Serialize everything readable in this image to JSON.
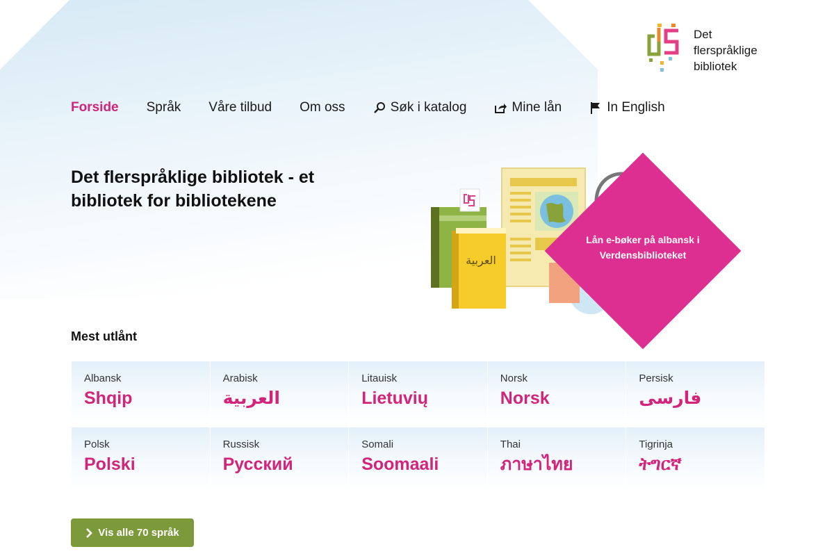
{
  "brand": {
    "logo_lines": [
      "Det",
      "flerspråklige",
      "bibliotek"
    ],
    "colors": {
      "pink": "#d1247a",
      "promo_pink": "#dd2e92",
      "green": "#7c9a3a",
      "bg_blue": "#dcebf6"
    }
  },
  "nav": {
    "items": [
      {
        "label": "Forside",
        "icon": "",
        "active": true
      },
      {
        "label": "Språk",
        "icon": ""
      },
      {
        "label": "Våre tilbud",
        "icon": ""
      },
      {
        "label": "Om oss",
        "icon": ""
      },
      {
        "label": "Søk i katalog",
        "icon": "search-icon"
      },
      {
        "label": "Mine lån",
        "icon": "share-icon"
      },
      {
        "label": "In English",
        "icon": "flag-icon"
      }
    ]
  },
  "hero": {
    "title": "Det flerspråklige bibliotek - et bibliotek for bibliotekene",
    "book_text": "العربية",
    "promo_text": "Lån e-bøker på albansk i Verdensbiblioteket"
  },
  "most_borrowed": {
    "title": "Mest utlånt",
    "languages": [
      {
        "name": "Albansk",
        "native": "Shqip"
      },
      {
        "name": "Arabisk",
        "native": "العربية"
      },
      {
        "name": "Litauisk",
        "native": "Lietuvių"
      },
      {
        "name": "Norsk",
        "native": "Norsk"
      },
      {
        "name": "Persisk",
        "native": "فارسی"
      },
      {
        "name": "Polsk",
        "native": "Polski"
      },
      {
        "name": "Russisk",
        "native": "Русский"
      },
      {
        "name": "Somali",
        "native": "Soomaali"
      },
      {
        "name": "Thai",
        "native": "ภาษาไทย"
      },
      {
        "name": "Tigrinja",
        "native": "ትግርኛ"
      }
    ],
    "cta_label": "Vis alle 70 språk",
    "cta_icon": "chevron-right-icon"
  }
}
